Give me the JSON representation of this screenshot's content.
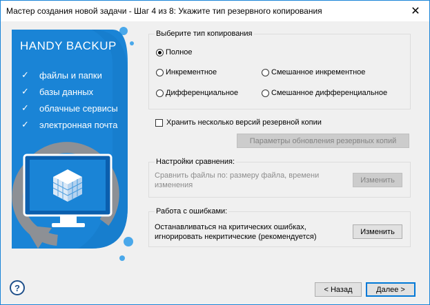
{
  "window": {
    "title": "Мастер создания новой задачи - Шаг 4 из 8: Укажите тип резервного копирования",
    "close_glyph": "✕"
  },
  "banner": {
    "brand": "HANDY BACKUP",
    "features": [
      "файлы и папки",
      "базы данных",
      "облачные сервисы",
      "электронная почта"
    ],
    "check_glyph": "✓",
    "colors": {
      "blue": "#1a84d6",
      "dark_blue": "#0b5fae",
      "gray": "#8d9095"
    }
  },
  "backup_type": {
    "title": "Выберите тип копирования",
    "options": {
      "full": "Полное",
      "incremental": "Инкрементное",
      "mixed_incremental": "Смешанное инкрементное",
      "differential": "Дифференциальное",
      "mixed_differential": "Смешанное дифференциальное"
    },
    "selected": "full"
  },
  "versions": {
    "checkbox_label": "Хранить несколько версий резервной копии",
    "checked": false,
    "params_button": "Параметры обновления резервных копий"
  },
  "comparison": {
    "title": "Настройки сравнения:",
    "text": "Сравнить файлы по: размеру файла, времени изменения",
    "button": "Изменить"
  },
  "errors": {
    "title": "Работа с ошибками:",
    "text": "Останавливаться на критических ошибках, игнорировать некритические (рекомендуется)",
    "button": "Изменить"
  },
  "footer": {
    "help": "?",
    "back": "< Назад",
    "next": "Далее >"
  }
}
